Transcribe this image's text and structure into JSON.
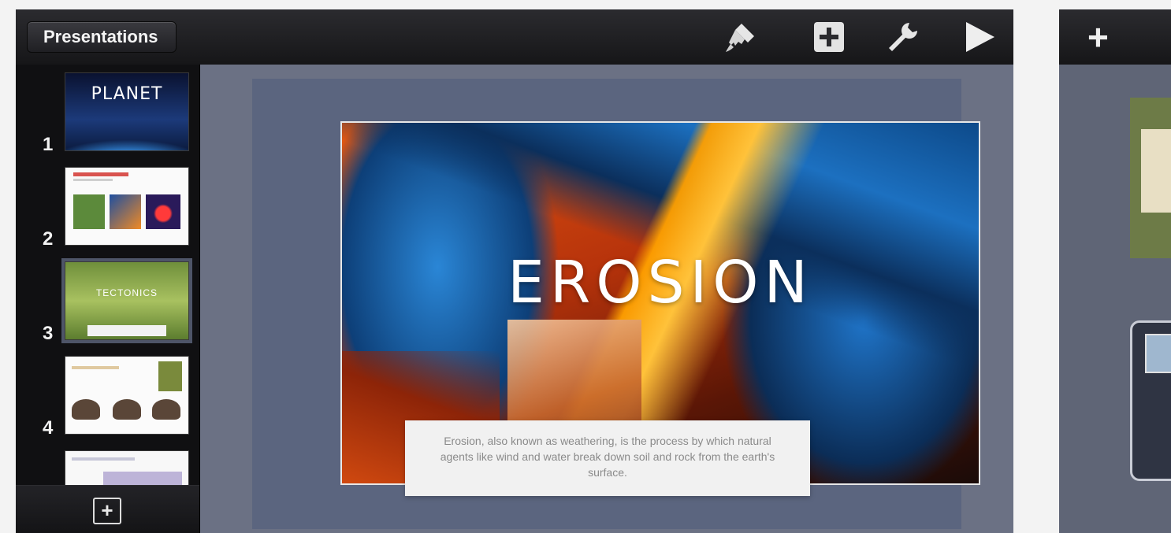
{
  "toolbar": {
    "back_label": "Presentations",
    "icons": [
      "paintbrush-icon",
      "add-media-icon",
      "wrench-icon",
      "play-icon"
    ]
  },
  "sidebar": {
    "slides": [
      {
        "number": "1",
        "title": "PLANET"
      },
      {
        "number": "2",
        "title": ""
      },
      {
        "number": "3",
        "title": "TECTONICS"
      },
      {
        "number": "4",
        "title": ""
      },
      {
        "number": "",
        "title": ""
      }
    ],
    "add_slide_icon": "add-slide-icon"
  },
  "slide": {
    "title": "EROSION",
    "caption": "Erosion, also known as weathering, is the process by which natural agents like wind and water break down soil and rock from the earth's surface."
  },
  "second_device": {
    "add_icon": "plus-icon",
    "add_label": "+"
  }
}
